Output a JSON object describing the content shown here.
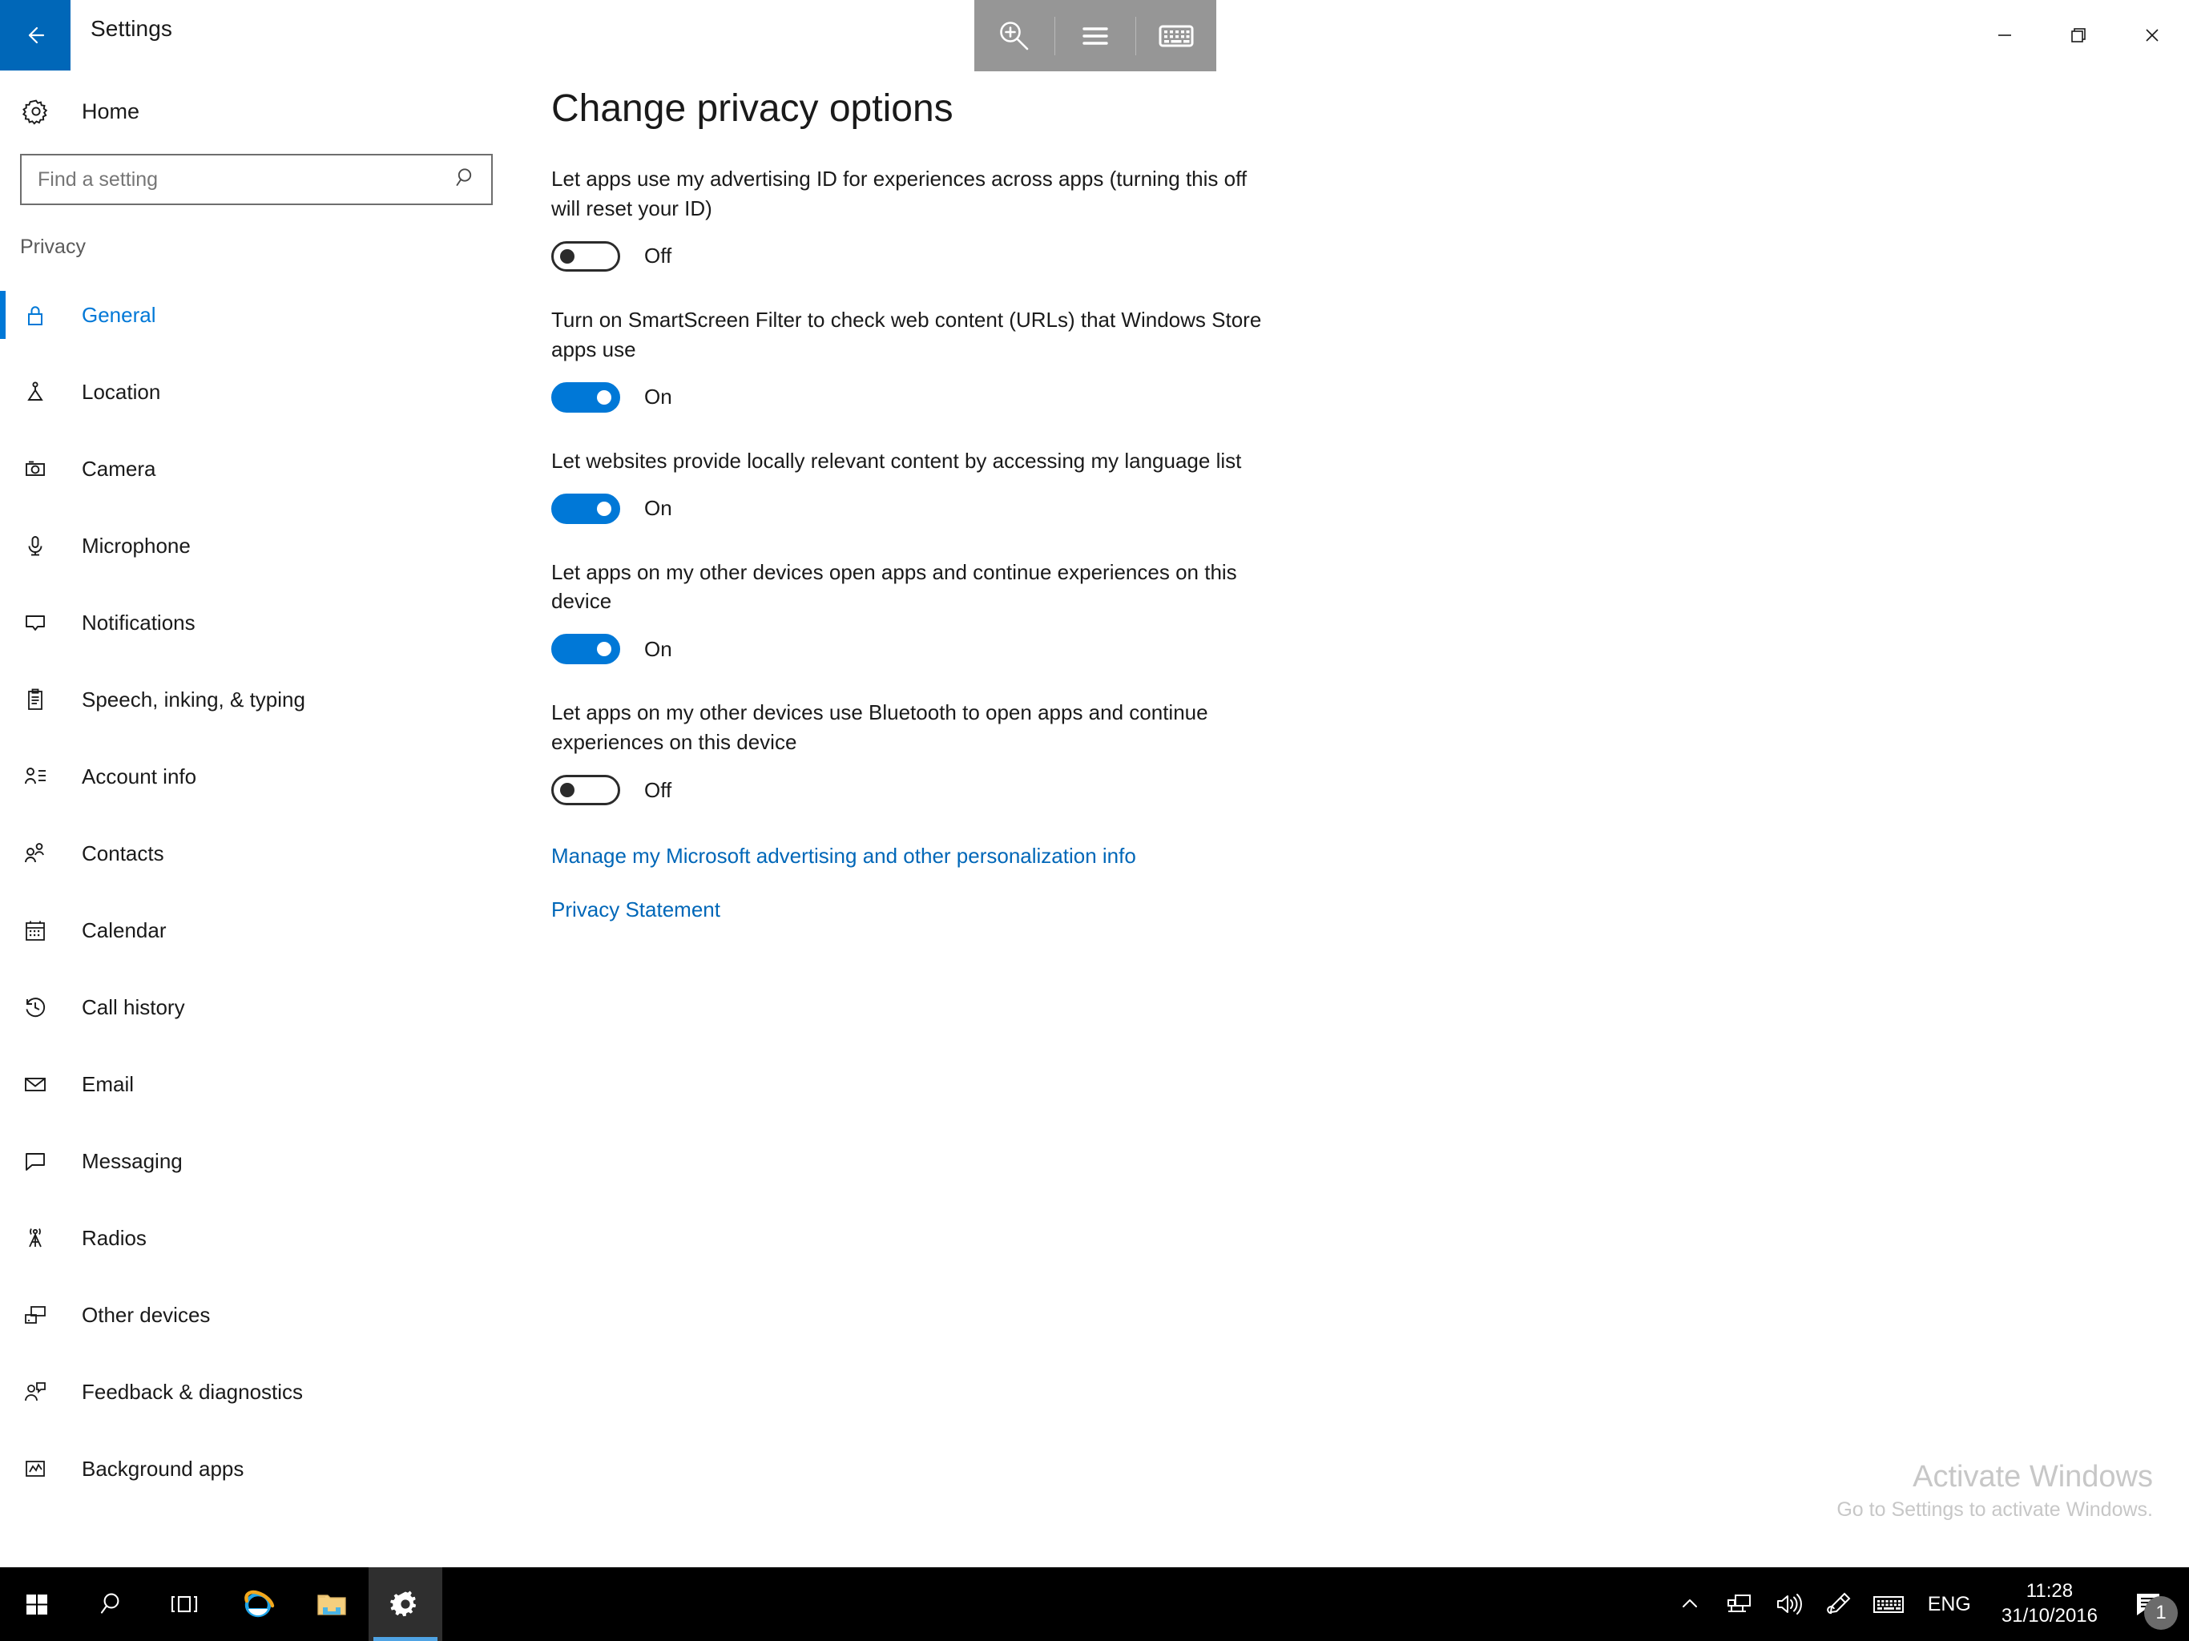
{
  "window": {
    "title": "Settings",
    "back_icon": "back-arrow-icon",
    "accent_color": "#0078d7",
    "titlebar_button_color": "#0067b8",
    "controls": {
      "minimize": "minimize-icon",
      "restore": "restore-icon",
      "close": "close-icon"
    }
  },
  "access_toolbar": {
    "zoom_in": "magnifier-plus-icon",
    "menu": "hamburger-menu-icon",
    "keyboard": "on-screen-keyboard-icon",
    "background_color": "#969696"
  },
  "sidebar": {
    "home": {
      "label": "Home",
      "icon": "gear-icon"
    },
    "search": {
      "placeholder": "Find a setting",
      "value": "",
      "icon": "search-icon"
    },
    "group_title": "Privacy",
    "items": [
      {
        "label": "General",
        "icon": "lock-icon",
        "selected": true
      },
      {
        "label": "Location",
        "icon": "location-pin-icon",
        "selected": false
      },
      {
        "label": "Camera",
        "icon": "camera-icon",
        "selected": false
      },
      {
        "label": "Microphone",
        "icon": "microphone-icon",
        "selected": false
      },
      {
        "label": "Notifications",
        "icon": "notification-bubble-icon",
        "selected": false
      },
      {
        "label": "Speech, inking, & typing",
        "icon": "clipboard-icon",
        "selected": false
      },
      {
        "label": "Account info",
        "icon": "account-list-icon",
        "selected": false
      },
      {
        "label": "Contacts",
        "icon": "contacts-icon",
        "selected": false
      },
      {
        "label": "Calendar",
        "icon": "calendar-icon",
        "selected": false
      },
      {
        "label": "Call history",
        "icon": "clock-history-icon",
        "selected": false
      },
      {
        "label": "Email",
        "icon": "envelope-icon",
        "selected": false
      },
      {
        "label": "Messaging",
        "icon": "message-bubble-icon",
        "selected": false
      },
      {
        "label": "Radios",
        "icon": "radio-tower-icon",
        "selected": false
      },
      {
        "label": "Other devices",
        "icon": "devices-icon",
        "selected": false
      },
      {
        "label": "Feedback & diagnostics",
        "icon": "feedback-person-icon",
        "selected": false
      },
      {
        "label": "Background apps",
        "icon": "background-apps-icon",
        "selected": false
      }
    ]
  },
  "main": {
    "title": "Change privacy options",
    "settings": [
      {
        "description": "Let apps use my advertising ID for experiences across apps (turning this off will reset your ID)",
        "state": "Off",
        "on": false
      },
      {
        "description": "Turn on SmartScreen Filter to check web content (URLs) that Windows Store apps use",
        "state": "On",
        "on": true
      },
      {
        "description": "Let websites provide locally relevant content by accessing my language list",
        "state": "On",
        "on": true
      },
      {
        "description": "Let apps on my other devices open apps and continue experiences on this device",
        "state": "On",
        "on": true
      },
      {
        "description": "Let apps on my other devices use Bluetooth to open apps and continue experiences on this device",
        "state": "Off",
        "on": false
      }
    ],
    "links": [
      "Manage my Microsoft advertising and other personalization info",
      "Privacy Statement"
    ]
  },
  "watermark": {
    "line1": "Activate Windows",
    "line2": "Go to Settings to activate Windows."
  },
  "taskbar": {
    "buttons": [
      {
        "name": "start-button",
        "icon": "windows-logo-icon",
        "active": false
      },
      {
        "name": "search-button",
        "icon": "search-icon",
        "active": false
      },
      {
        "name": "task-view-button",
        "icon": "task-view-icon",
        "active": false
      },
      {
        "name": "internet-explorer-button",
        "icon": "internet-explorer-icon",
        "active": false
      },
      {
        "name": "file-explorer-button",
        "icon": "file-explorer-icon",
        "active": false
      },
      {
        "name": "settings-button",
        "icon": "gear-icon",
        "active": true
      }
    ],
    "tray": {
      "chevron": "chevron-up-icon",
      "network": "network-icon",
      "volume": "volume-icon",
      "pen": "pen-icon",
      "keyboard": "touch-keyboard-icon",
      "language": "ENG",
      "time": "11:28",
      "date": "31/10/2016",
      "action_center": "action-center-icon",
      "notification_count": "1"
    }
  }
}
